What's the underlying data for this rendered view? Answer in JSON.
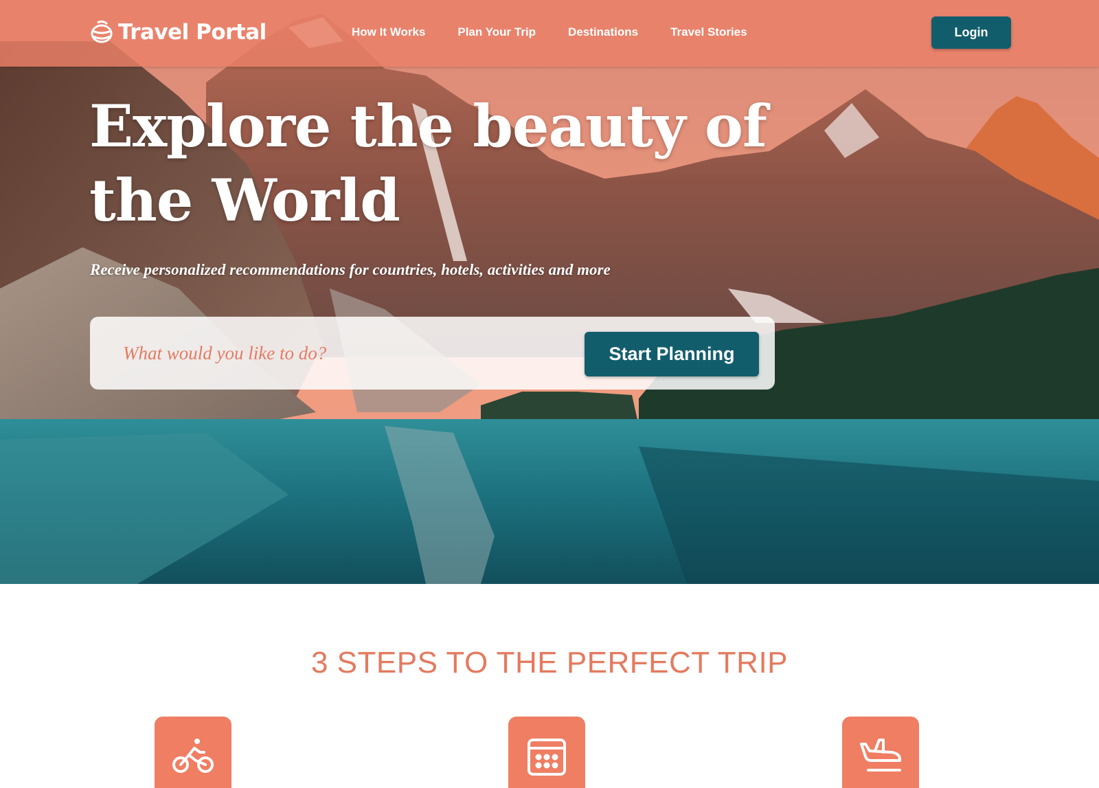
{
  "header": {
    "logo_text": "Travel Portal",
    "logo_icon": "globe-icon",
    "nav": [
      {
        "label": "How It Works"
      },
      {
        "label": "Plan Your Trip"
      },
      {
        "label": "Destinations"
      },
      {
        "label": "Travel Stories"
      }
    ],
    "login_label": "Login"
  },
  "hero": {
    "title": "Explore the beauty of the World",
    "subtitle": "Receive personalized recommendations for countries, hotels, activities and more",
    "search": {
      "placeholder": "What would you like to do?",
      "value": "",
      "button_label": "Start Planning"
    }
  },
  "steps": {
    "heading": "3 STEPS TO THE PERFECT TRIP",
    "items": [
      {
        "icon": "bicycle-icon"
      },
      {
        "icon": "calendar-icon"
      },
      {
        "icon": "airplane-landing-icon"
      }
    ]
  },
  "colors": {
    "header_overlay": "#ec8068",
    "primary_button": "#125d6c",
    "accent": "#e47a5f",
    "step_icon_bg": "#ef7e63"
  }
}
